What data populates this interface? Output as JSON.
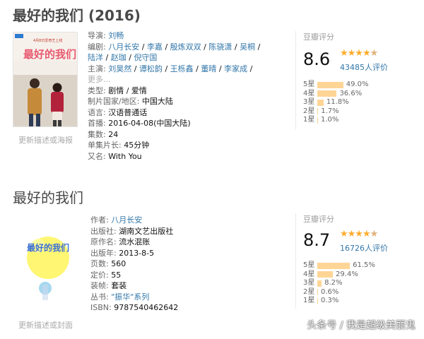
{
  "movie": {
    "title": "最好的我们 (2016)",
    "update_link": "更新描述或海报",
    "info": {
      "director_label": "导演:",
      "director": "刘畅",
      "writers_label": "编剧:",
      "writers_line1": [
        "八月长安",
        "李嘉",
        "殷炼双双",
        "陈骁潇",
        "吴桐"
      ],
      "writers_line2": [
        "陆洋",
        "赵珈",
        "倪守国"
      ],
      "cast_label": "主演:",
      "cast": [
        "刘昊然",
        "谭松韵",
        "王栎鑫",
        "董晴",
        "李家成"
      ],
      "more": "更多...",
      "genre_label": "类型:",
      "genre": "剧情 / 爱情",
      "region_label": "制片国家/地区:",
      "region": "中国大陆",
      "language_label": "语言:",
      "language": "汉语普通话",
      "premiere_label": "首播:",
      "premiere": "2016-04-08(中国大陆)",
      "episodes_label": "集数:",
      "episodes": "24",
      "runtime_label": "单集片长:",
      "runtime": "45分钟",
      "aka_label": "又名:",
      "aka": "With You"
    },
    "rating": {
      "header": "豆瓣评分",
      "score": "8.6",
      "stars": "★★★★",
      "half_star": "★",
      "votes": "43485人评价",
      "bars": [
        {
          "level": "5星",
          "pct": "49.0%",
          "value": 49.0
        },
        {
          "level": "4星",
          "pct": "36.6%",
          "value": 36.6
        },
        {
          "level": "3星",
          "pct": "11.8%",
          "value": 11.8
        },
        {
          "level": "2星",
          "pct": "1.7%",
          "value": 1.7
        },
        {
          "level": "1星",
          "pct": "1.0%",
          "value": 1.0
        }
      ]
    },
    "poster_text": {
      "date": "4月8日爱奇艺上线",
      "name": "最好的我们"
    }
  },
  "book": {
    "title": "最好的我们",
    "update_link": "更新描述或封面",
    "info": {
      "author_label": "作者:",
      "author": "八月长安",
      "publisher_label": "出版社:",
      "publisher": "湖南文艺出版社",
      "original_label": "原作名:",
      "original": "流水混账",
      "pubyear_label": "出版年:",
      "pubyear": "2013-8-5",
      "pages_label": "页数:",
      "pages": "560",
      "price_label": "定价:",
      "price": "55",
      "binding_label": "装帧:",
      "binding": "套装",
      "series_label": "丛书:",
      "series": "\"振华\"系列",
      "isbn_label": "ISBN:",
      "isbn": "9787540462642"
    },
    "rating": {
      "header": "豆瓣评分",
      "score": "8.7",
      "stars": "★★★★",
      "half_star": "★",
      "votes": "16726人评价",
      "bars": [
        {
          "level": "5星",
          "pct": "61.5%",
          "value": 61.5
        },
        {
          "level": "4星",
          "pct": "29.4%",
          "value": 29.4
        },
        {
          "level": "3星",
          "pct": "8.2%",
          "value": 8.2
        },
        {
          "level": "2星",
          "pct": "0.6%",
          "value": 0.6
        },
        {
          "level": "1星",
          "pct": "0.3%",
          "value": 0.3
        }
      ]
    },
    "cover_text": {
      "name": "最好的我们"
    }
  },
  "watermark": "头条号 / 我是超级美丽鬼",
  "colors": {
    "link": "#3377aa",
    "star": "#ffac2d",
    "bar": "#ffd596"
  }
}
